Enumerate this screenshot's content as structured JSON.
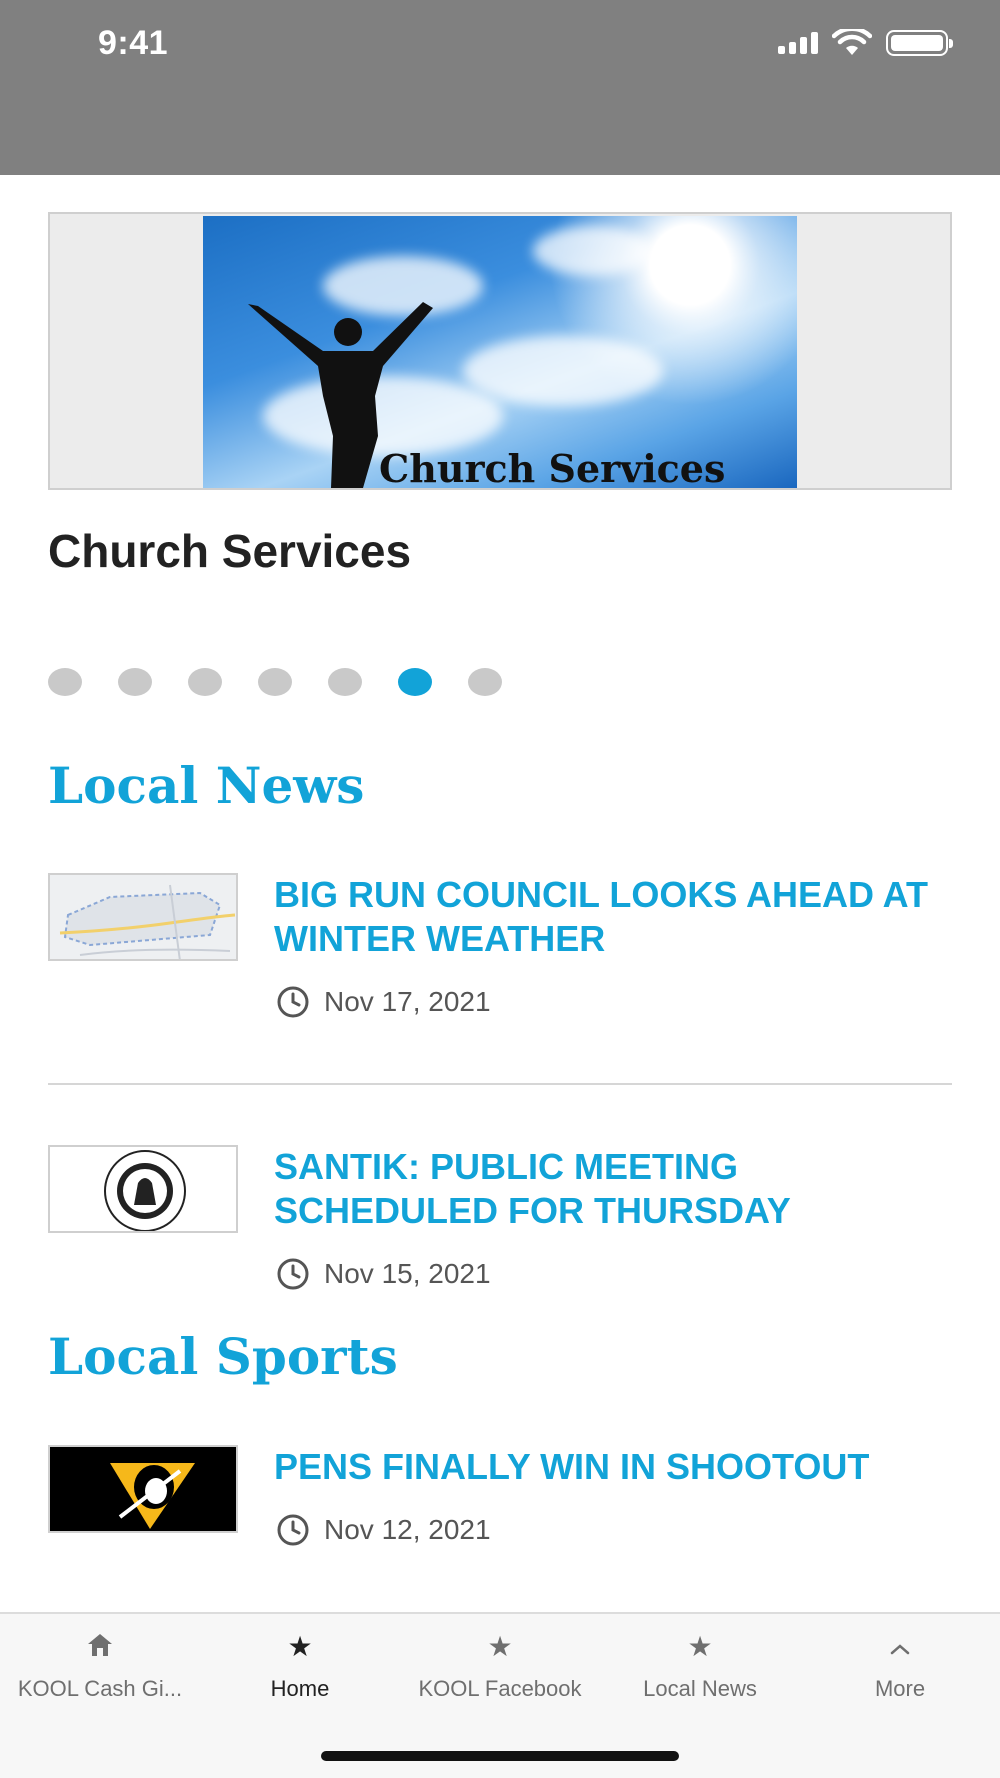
{
  "status_bar": {
    "time": "9:41"
  },
  "carousel": {
    "image_caption": "Church Services",
    "title": "Church Services",
    "dots_total": 7,
    "active_index": 5
  },
  "local_news": {
    "heading": "Local News",
    "items": [
      {
        "headline": "BIG RUN COUNCIL LOOKS AHEAD AT WINTER WEATHER",
        "date": "Nov 17, 2021",
        "thumb": "map-thumbnail"
      },
      {
        "headline": "SANTIK: PUBLIC MEETING SCHEDULED FOR THURSDAY",
        "date": "Nov 15, 2021",
        "thumb": "borough-seal-thumbnail"
      }
    ]
  },
  "local_sports": {
    "heading": "Local Sports",
    "items": [
      {
        "headline": "PENS FINALLY WIN IN SHOOTOUT",
        "date": "Nov 12, 2021",
        "thumb": "penguins-logo-thumbnail"
      }
    ]
  },
  "tabbar": {
    "tabs": [
      {
        "label": "KOOL Cash Gi...",
        "icon": "home-icon"
      },
      {
        "label": "Home",
        "icon": "star-icon",
        "active": true
      },
      {
        "label": "KOOL Facebook",
        "icon": "star-icon"
      },
      {
        "label": "Local News",
        "icon": "star-icon"
      },
      {
        "label": "More",
        "icon": "chevron-up-icon"
      }
    ]
  },
  "colors": {
    "accent": "#12a3d8",
    "top_bar": "#808080"
  }
}
